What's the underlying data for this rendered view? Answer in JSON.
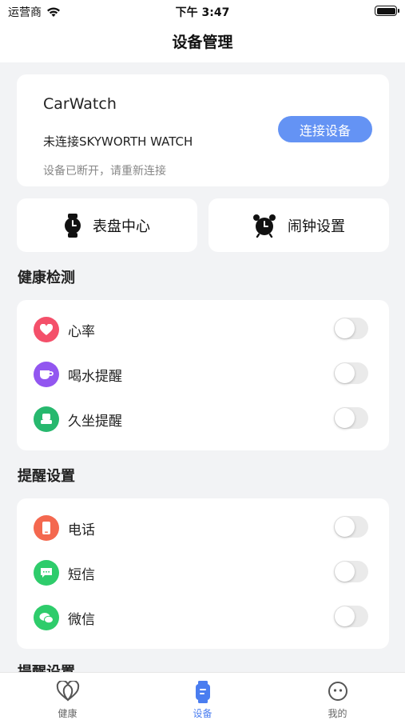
{
  "status_bar": {
    "carrier": "运营商",
    "time": "下午 3:47"
  },
  "nav": {
    "title": "设备管理"
  },
  "device": {
    "name": "CarWatch",
    "connection": "未连接SKYWORTH WATCH",
    "note": "设备已断开，请重新连接",
    "connect_label": "连接设备"
  },
  "quick_actions": [
    {
      "label": "表盘中心",
      "icon": "watch-icon"
    },
    {
      "label": "闹钟设置",
      "icon": "alarm-clock-icon"
    }
  ],
  "health": {
    "title": "健康检测",
    "items": [
      {
        "label": "心率",
        "icon": "heart-icon",
        "color": "#f4506a",
        "enabled": false
      },
      {
        "label": "喝水提醒",
        "icon": "cup-icon",
        "color": "#9256f0",
        "enabled": false
      },
      {
        "label": "久坐提醒",
        "icon": "seat-icon",
        "color": "#27b86e",
        "enabled": false
      }
    ]
  },
  "reminders": {
    "title": "提醒设置",
    "items": [
      {
        "label": "电话",
        "icon": "phone-icon",
        "color": "#f4684f",
        "enabled": false
      },
      {
        "label": "短信",
        "icon": "message-icon",
        "color": "#2ecc6b",
        "enabled": false
      },
      {
        "label": "微信",
        "icon": "wechat-icon",
        "color": "#2ecc6b",
        "enabled": false
      }
    ]
  },
  "partial_section": {
    "title": "提醒设置"
  },
  "tabbar": {
    "tabs": [
      {
        "label": "健康",
        "icon": "health-icon",
        "active": false
      },
      {
        "label": "设备",
        "icon": "device-icon",
        "active": true
      },
      {
        "label": "我的",
        "icon": "profile-icon",
        "active": false
      }
    ],
    "active_color": "#4a7df0"
  }
}
